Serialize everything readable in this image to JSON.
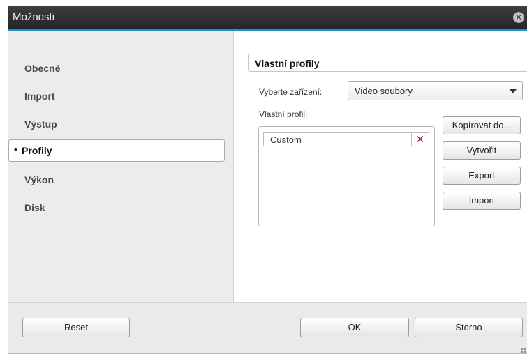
{
  "window": {
    "title": "Možnosti"
  },
  "sidebar": {
    "items": [
      {
        "label": "Obecné",
        "active": false
      },
      {
        "label": "Import",
        "active": false
      },
      {
        "label": "Výstup",
        "active": false
      },
      {
        "label": "Profily",
        "active": true
      },
      {
        "label": "Výkon",
        "active": false
      },
      {
        "label": "Disk",
        "active": false
      }
    ],
    "bullet": "•"
  },
  "main": {
    "section_title": "Vlastní profily",
    "device_label": "Vyberte zařízení:",
    "device_value": "Video soubory",
    "profile_label": "Vlastní profil:",
    "profiles": [
      {
        "name": "Custom"
      }
    ],
    "buttons": {
      "copy": "Kopírovat do...",
      "create": "Vytvořit",
      "export": "Export",
      "import": "Import"
    }
  },
  "footer": {
    "reset": "Reset",
    "ok": "OK",
    "cancel": "Storno"
  },
  "colors": {
    "accent": "#1c8fd6",
    "delete": "#c8141c"
  },
  "icons": {
    "close": "close-icon",
    "delete": "delete-icon",
    "dropdown": "chevron-down-icon"
  }
}
